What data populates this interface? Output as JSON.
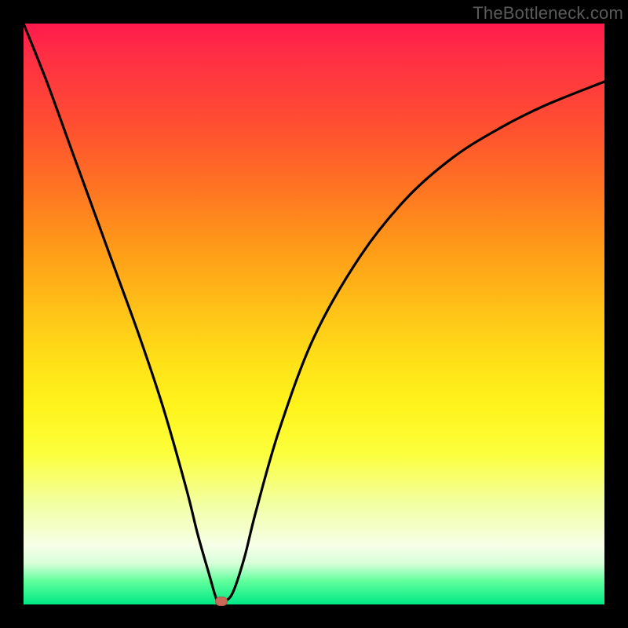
{
  "watermark": "TheBottleneck.com",
  "chart_data": {
    "type": "line",
    "title": "",
    "xlabel": "",
    "ylabel": "",
    "xlim": [
      0,
      100
    ],
    "ylim": [
      0,
      100
    ],
    "grid": false,
    "legend": false,
    "background_gradient": {
      "top": "#ff1a4c",
      "mid": "#ffe018",
      "bottom": "#00e886"
    },
    "series": [
      {
        "name": "bottleneck-curve",
        "color": "#000000",
        "x": [
          0,
          4,
          8,
          12,
          16,
          20,
          24,
          28,
          30,
          32,
          33,
          33.5,
          34.5,
          36,
          38,
          40,
          44,
          50,
          58,
          66,
          74,
          82,
          90,
          100
        ],
        "y": [
          100,
          90,
          79,
          68,
          57,
          46,
          34,
          20,
          12,
          5,
          1.5,
          0.5,
          0.5,
          2,
          8,
          16,
          30,
          46,
          60,
          70,
          77,
          82,
          86,
          90
        ]
      }
    ],
    "marker": {
      "name": "optimal-point",
      "x": 34,
      "y": 0.5,
      "color": "#c86a58"
    }
  }
}
